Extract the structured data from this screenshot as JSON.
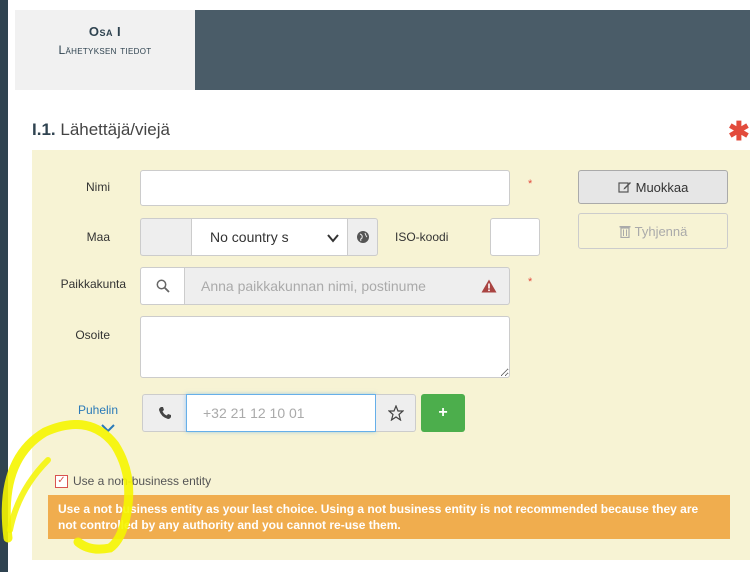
{
  "tab": {
    "title": "Osa I",
    "subtitle": "Lähetyksen tiedot"
  },
  "section": {
    "number": "I.1.",
    "title": "Lähettäjä/viejä",
    "required_mark": "✱"
  },
  "form": {
    "name_label": "Nimi",
    "name_value": "",
    "country_label": "Maa",
    "country_value": "No country s",
    "iso_label": "ISO-koodi",
    "iso_value": "",
    "city_label": "Paikkakunta",
    "city_placeholder": "Anna paikkakunnan nimi, postinume",
    "address_label": "Osoite",
    "address_value": "",
    "phone_label": "Puhelin",
    "phone_value": "+32 21 12 10 01",
    "required_small": "*"
  },
  "buttons": {
    "edit_label": "Muokkaa",
    "clear_label": "Tyhjennä",
    "add_phone_label": "+"
  },
  "checkbox": {
    "label": "Use a non-business entity",
    "checked": true
  },
  "warning": {
    "text": "Use a not business entity as your last choice. Using a not business entity is not recommended because they are not controlled by any authority and you cannot re-use them."
  },
  "icons": {
    "globe": "globe-icon",
    "search": "search-icon",
    "alert": "warning-triangle-icon",
    "phone": "phone-icon",
    "star": "star-icon",
    "edit": "edit-icon",
    "trash": "trash-icon",
    "chevron": "chevron-down-icon"
  },
  "colors": {
    "panel_bg": "#f7f3d4",
    "warning_bg": "#f0ad4e",
    "required_red": "#e24b3c",
    "success_green": "#4cae4c",
    "header_dark": "#4a5c68",
    "highlight_yellow": "#f5f500"
  }
}
